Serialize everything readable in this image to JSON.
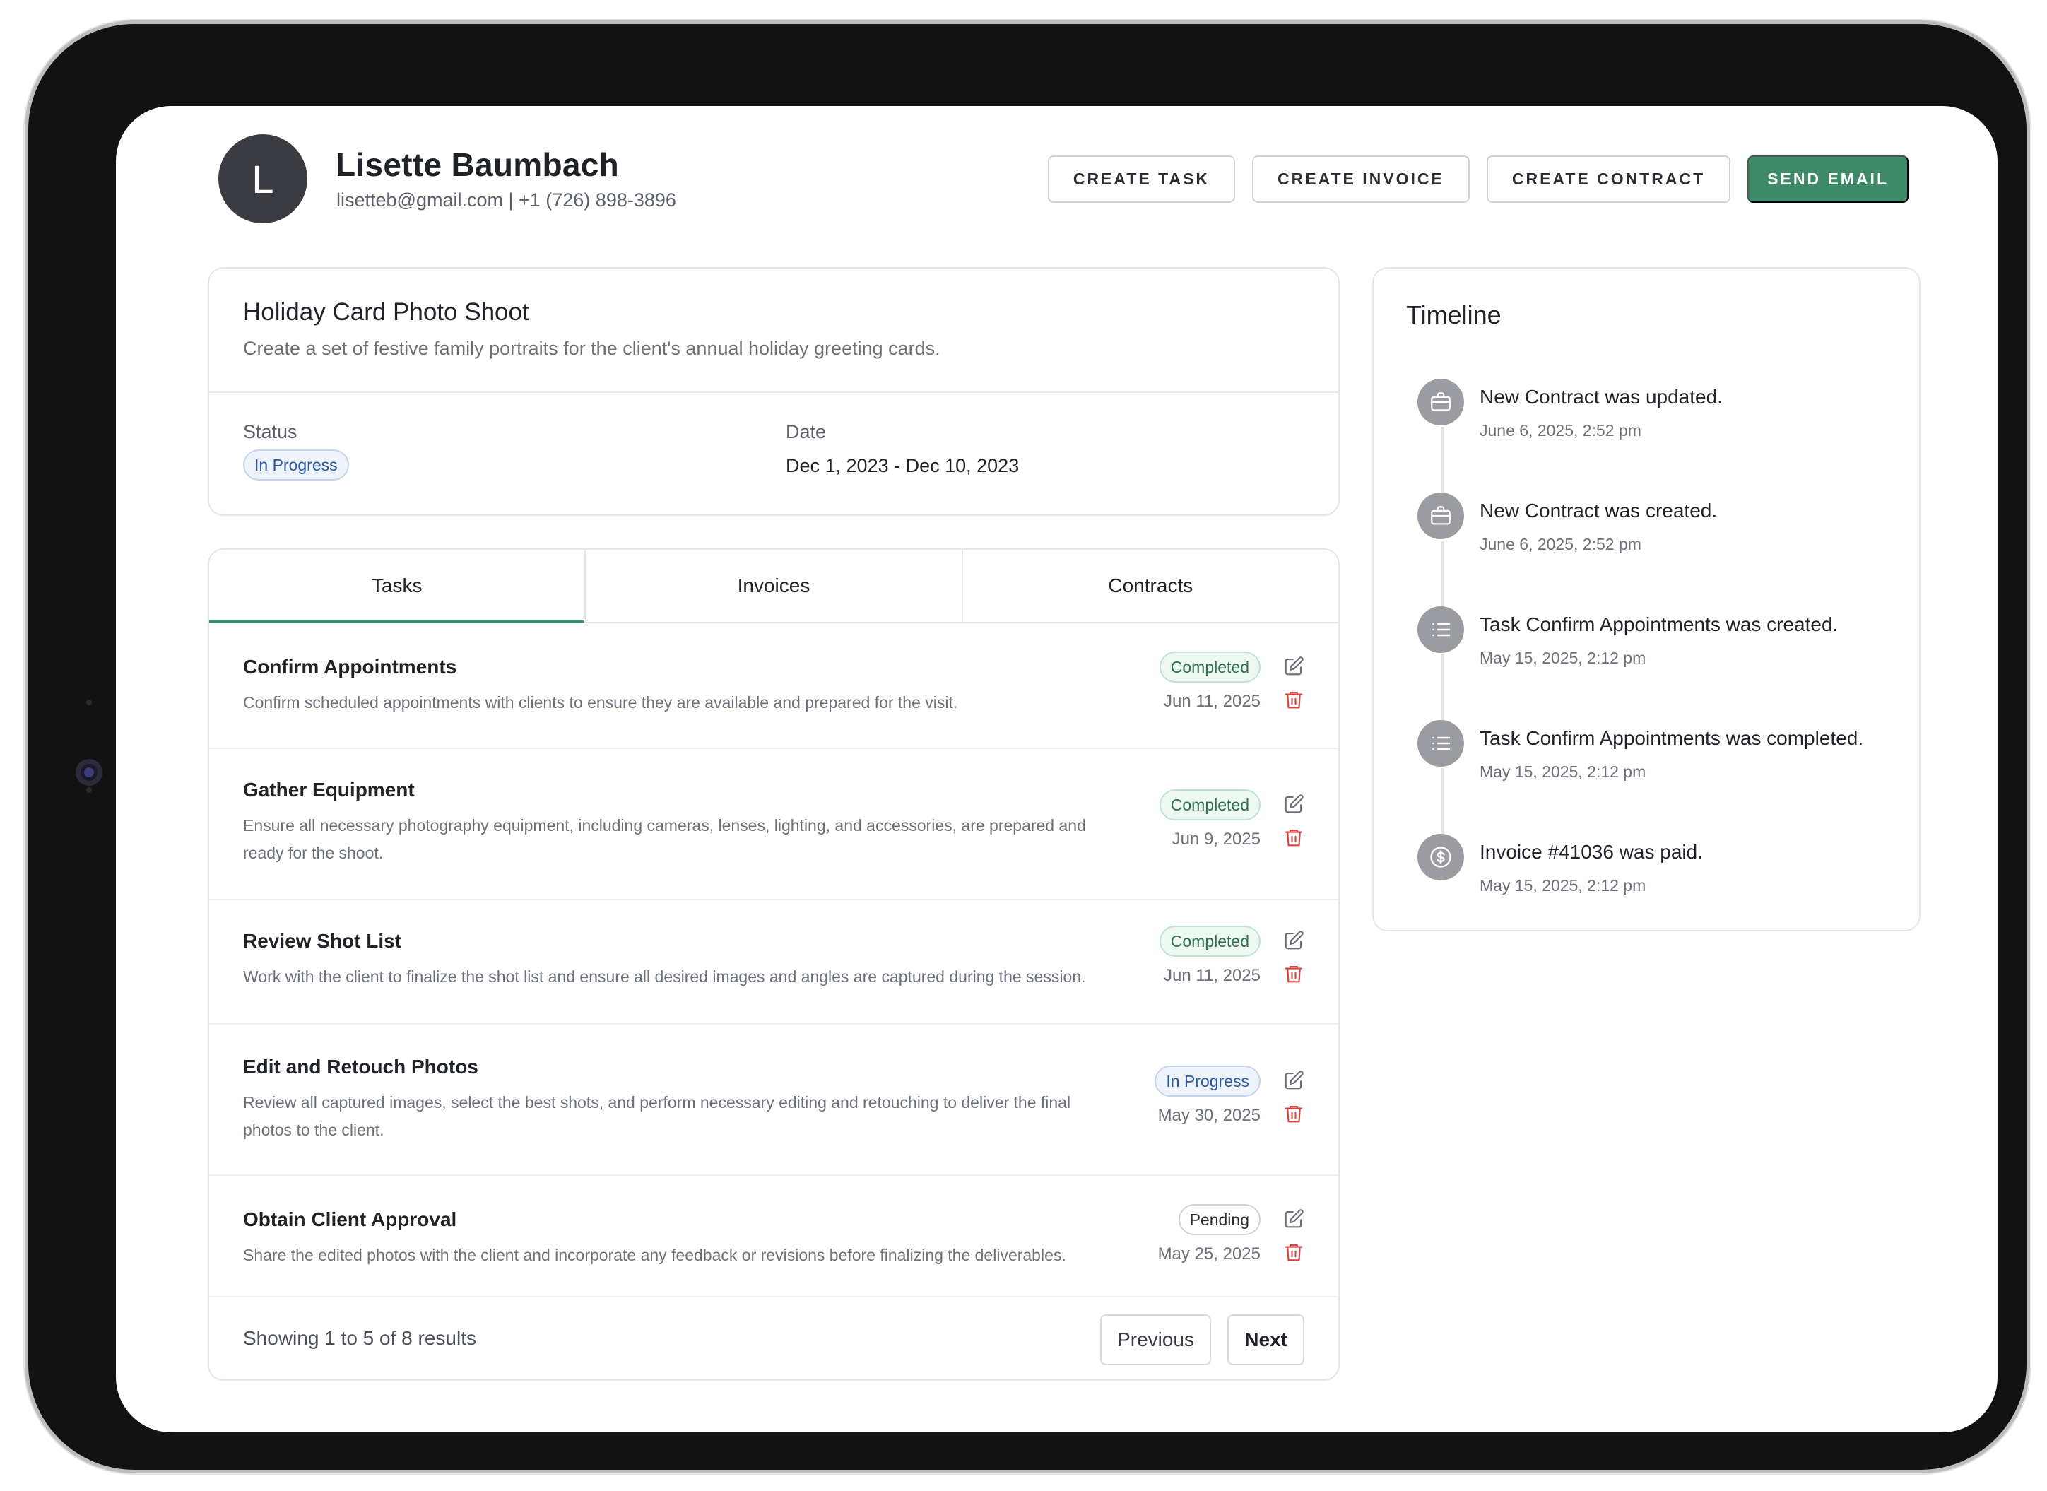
{
  "client": {
    "initial": "L",
    "name": "Lisette Baumbach",
    "contact": "lisetteb@gmail.com | +1 (726) 898-3896"
  },
  "actions": {
    "create_task": "CREATE TASK",
    "create_invoice": "CREATE INVOICE",
    "create_contract": "CREATE CONTRACT",
    "send_email": "SEND EMAIL"
  },
  "project": {
    "title": "Holiday Card Photo Shoot",
    "description": "Create a set of festive family portraits for the client's annual holiday greeting cards.",
    "status_label": "Status",
    "status": "In Progress",
    "date_label": "Date",
    "date": "Dec 1, 2023 - Dec 10, 2023"
  },
  "tabs": [
    {
      "label": "Tasks",
      "active": true
    },
    {
      "label": "Invoices",
      "active": false
    },
    {
      "label": "Contracts",
      "active": false
    }
  ],
  "tasks": [
    {
      "title": "Confirm Appointments",
      "description": "Confirm scheduled appointments with clients to ensure they are available and prepared for the visit.",
      "status": "Completed",
      "date": "Jun 11, 2025"
    },
    {
      "title": "Gather Equipment",
      "description": "Ensure all necessary photography equipment, including cameras, lenses, lighting, and accessories, are prepared and ready for the shoot.",
      "status": "Completed",
      "date": "Jun 9, 2025"
    },
    {
      "title": "Review Shot List",
      "description": "Work with the client to finalize the shot list and ensure all desired images and angles are captured during the session.",
      "status": "Completed",
      "date": "Jun 11, 2025"
    },
    {
      "title": "Edit and Retouch Photos",
      "description": "Review all captured images, select the best shots, and perform necessary editing and retouching to deliver the final photos to the client.",
      "status": "In Progress",
      "date": "May 30, 2025"
    },
    {
      "title": "Obtain Client Approval",
      "description": "Share the edited photos with the client and incorporate any feedback or revisions before finalizing the deliverables.",
      "status": "Pending",
      "date": "May 25, 2025"
    }
  ],
  "pagination": {
    "summary": "Showing 1 to 5 of 8 results",
    "previous": "Previous",
    "next": "Next"
  },
  "timeline": {
    "title": "Timeline",
    "events": [
      {
        "icon": "briefcase-icon",
        "text": "New Contract was updated.",
        "time": "June 6, 2025, 2:52 pm"
      },
      {
        "icon": "briefcase-icon",
        "text": "New Contract was created.",
        "time": "June 6, 2025, 2:52 pm"
      },
      {
        "icon": "list-icon",
        "text": "Task Confirm Appointments was created.",
        "time": "May 15, 2025, 2:12 pm"
      },
      {
        "icon": "list-icon",
        "text": "Task Confirm Appointments was completed.",
        "time": "May 15, 2025, 2:12 pm"
      },
      {
        "icon": "dollar-icon",
        "text": "Invoice #41036 was paid.",
        "time": "May 15, 2025, 2:12 pm"
      }
    ]
  },
  "colors": {
    "accent": "#3f8a69",
    "delete": "#d9413d",
    "timeline_icon_bg": "#9b9ca1"
  }
}
